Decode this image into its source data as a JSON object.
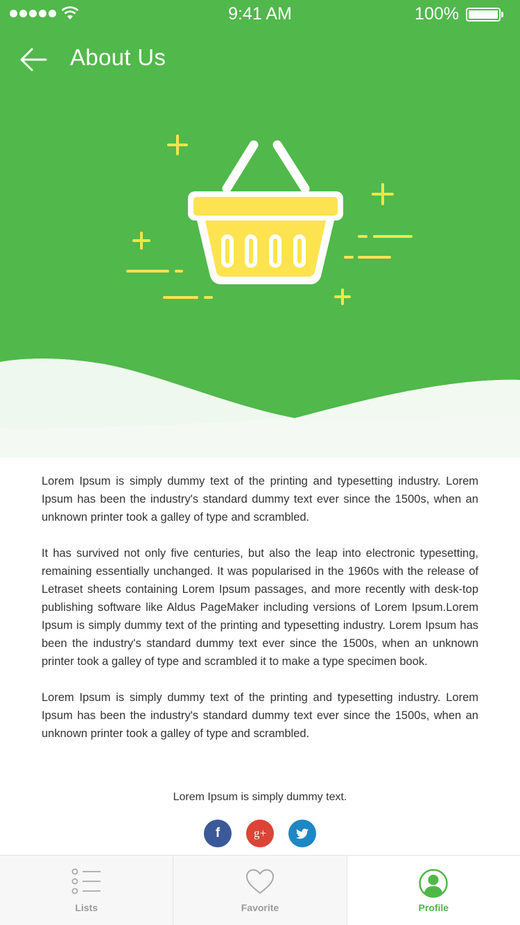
{
  "colors": {
    "primary": "#51b84b",
    "accent_yellow": "#fde350",
    "facebook": "#3b5998",
    "google_plus": "#db4437",
    "twitter": "#1f87c5"
  },
  "status_bar": {
    "time": "9:41 AM",
    "battery": "100%"
  },
  "header": {
    "title": "About Us",
    "back_icon": "arrow-left-icon"
  },
  "hero": {
    "illustration": "shopping-basket-icon"
  },
  "content": {
    "paragraphs": [
      "Lorem Ipsum is simply dummy text of the printing and typesetting industry. Lorem Ipsum has been the industry's standard dummy text ever since the 1500s, when an unknown printer took a galley of type and scrambled.",
      "It has survived not only five centuries, but also the leap into electronic typesetting, remaining essentially unchanged. It was popularised in the 1960s with the release of Letraset sheets containing Lorem Ipsum passages, and more recently with desk-top publishing software like Aldus PageMaker including versions of Lorem Ipsum.Lorem Ipsum is simply dummy text of the printing and typesetting industry. Lorem Ipsum has been the industry's standard dummy text ever since the 1500s, when an unknown printer took a galley of type and scrambled it to make a type specimen book.",
      "Lorem Ipsum is simply dummy text of the printing and typesetting industry. Lorem Ipsum has been the industry's standard dummy text ever since the 1500s, when an unknown printer took a galley of type and scrambled."
    ],
    "tagline": "Lorem Ipsum is simply dummy text."
  },
  "social": [
    {
      "name": "facebook",
      "glyph": "f",
      "icon": "facebook-icon"
    },
    {
      "name": "google-plus",
      "glyph": "g+",
      "icon": "google-plus-icon"
    },
    {
      "name": "twitter",
      "glyph": "",
      "icon": "twitter-icon"
    }
  ],
  "tabs": [
    {
      "label": "Lists",
      "icon": "list-icon",
      "active": false
    },
    {
      "label": "Favorite",
      "icon": "heart-icon",
      "active": false
    },
    {
      "label": "Profile",
      "icon": "user-profile-icon",
      "active": true
    }
  ]
}
